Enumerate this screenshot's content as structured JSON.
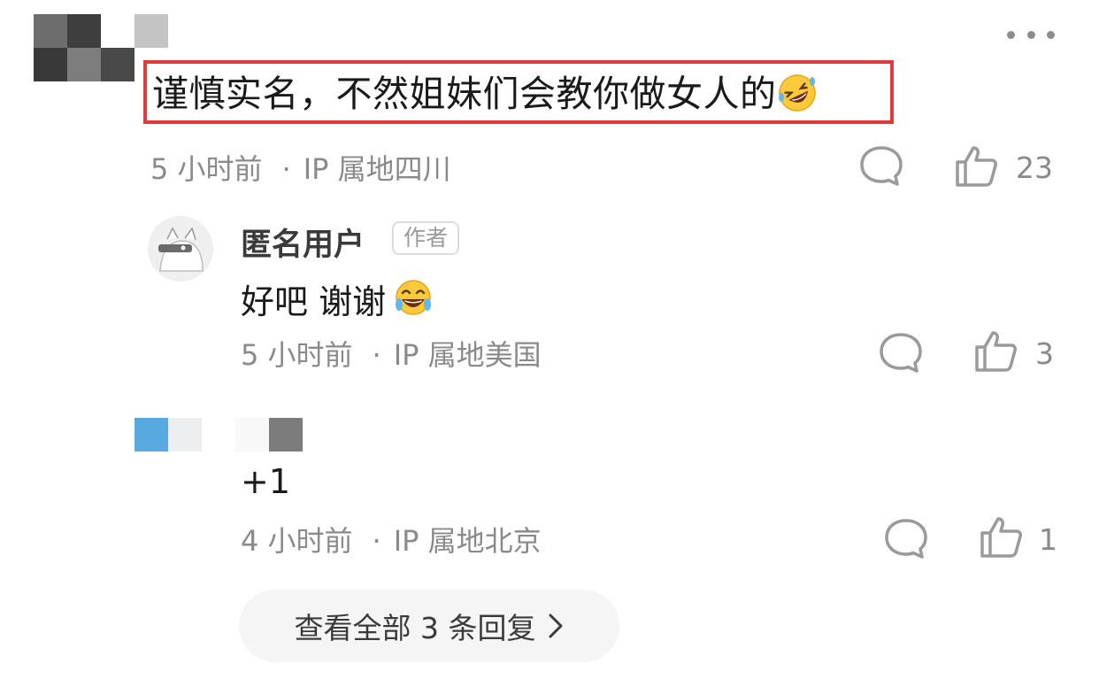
{
  "comment": {
    "text": "谨慎实名，不然姐妹们会教你做女人的",
    "emoji": "rolling-on-floor-laughing",
    "time": "5 小时前",
    "sep": "·",
    "location": "IP 属地四川",
    "likes": "23"
  },
  "replies": [
    {
      "username": "匿名用户",
      "badge": "作者",
      "text": "好吧 谢谢",
      "emoji": "tears-of-joy",
      "time": "5 小时前",
      "sep": "·",
      "location": "IP 属地美国",
      "likes": "3"
    },
    {
      "text": "+1",
      "time": "4 小时前",
      "sep": "·",
      "location": "IP 属地北京",
      "likes": "1"
    }
  ],
  "view_all": {
    "label": "查看全部 3 条回复",
    "chevron": "chevron-right-icon"
  },
  "colors": {
    "highlight": "#e23a3a",
    "meta_text": "#8a8a8a",
    "icon": "#9a9a9a"
  }
}
